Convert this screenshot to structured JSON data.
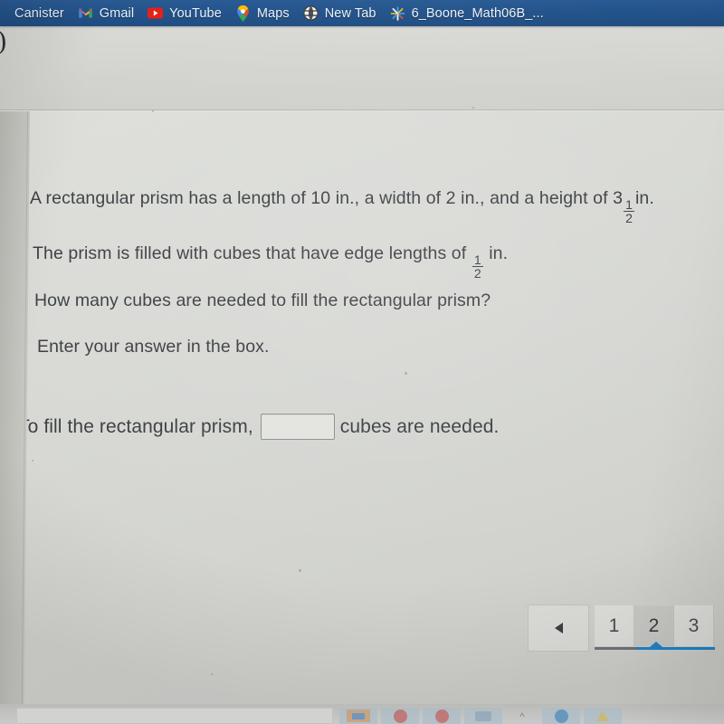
{
  "bookmarks_bar": {
    "background_color": "#24548c",
    "items": [
      {
        "label": "Canister",
        "icon": "clipped-favicon-icon"
      },
      {
        "label": "Gmail",
        "icon": "gmail-icon"
      },
      {
        "label": "YouTube",
        "icon": "youtube-icon"
      },
      {
        "label": "Maps",
        "icon": "google-maps-pin-icon"
      },
      {
        "label": "New Tab",
        "icon": "globe-icon"
      },
      {
        "label": "6_Boone_Math06B_...",
        "icon": "starburst-icon"
      }
    ]
  },
  "chrome": {
    "partial_glyph": ")"
  },
  "question": {
    "line1_a": "A rectangular prism has a length of 10 in., a width of 2 in., and a height of 3",
    "line1_frac_num": "1",
    "line1_frac_den": "2",
    "line1_b": "in.",
    "line2_a": "The prism is filled with cubes that have edge lengths of",
    "line2_frac_num": "1",
    "line2_frac_den": "2",
    "line2_b": "in.",
    "line3": "How many cubes are needed to fill the rectangular prism?",
    "line4": "Enter your answer in the box."
  },
  "answer": {
    "prefix": "To fill the rectangular prism,",
    "input_value": "",
    "input_placeholder": "",
    "suffix": "cubes are needed."
  },
  "pagination": {
    "prev_icon": "triangle-left-icon",
    "pages": [
      "1",
      "2",
      "3"
    ],
    "active_page": "2",
    "accent_color": "#1f84c9"
  },
  "taskbar": {
    "tray_icons": [
      "orange-app-icon",
      "red-circle-icon",
      "red-circle-icon",
      "camera-icon",
      "chevron-up-icon",
      "blue-circle-icon",
      "yellow-triangle-icon"
    ]
  }
}
